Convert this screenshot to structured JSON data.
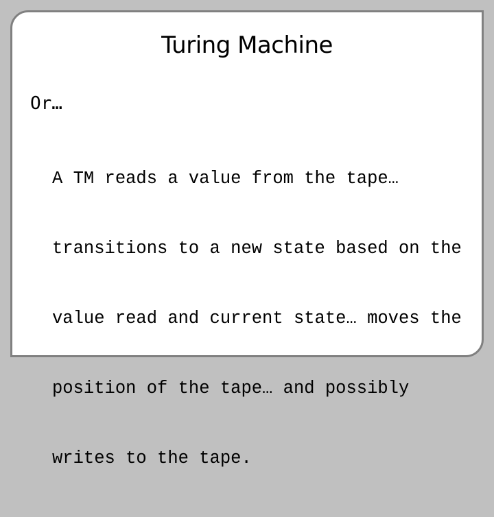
{
  "slide": {
    "title": "Turing Machine",
    "bullet": "Or…",
    "sub_bullet_lines": [
      "A TM reads a value from the tape…",
      "transitions to a new state based on the",
      "value read and current state… moves the",
      "position of the tape… and possibly",
      "writes to the tape."
    ]
  },
  "colors": {
    "background": "#c0c0c0",
    "slide_border": "#808080",
    "slide_fill": "#ffffff",
    "text": "#000000"
  }
}
